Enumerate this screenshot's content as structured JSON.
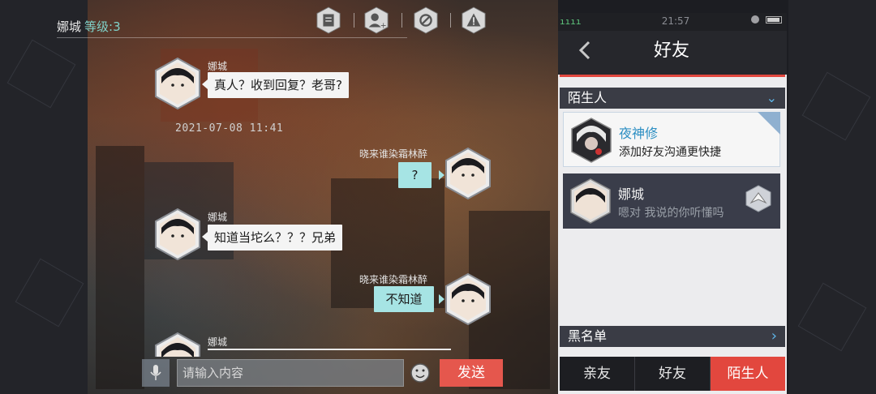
{
  "chat": {
    "header": {
      "name": "娜城",
      "level_label": "等级:3"
    },
    "timestamp": "2021-07-08 11:41",
    "messages": [
      {
        "sender": "娜城",
        "text": "真人？收到回复？老哥?",
        "side": "left"
      },
      {
        "sender": "晓来谁染霜林醉",
        "text": "?",
        "side": "right"
      },
      {
        "sender": "娜城",
        "text": "知道当坨么？？？兄弟",
        "side": "left"
      },
      {
        "sender": "晓来谁染霜林醉",
        "text": "不知道",
        "side": "right"
      },
      {
        "sender": "娜城",
        "text": "",
        "side": "left"
      }
    ],
    "toolbar_icons": [
      "notes-icon",
      "add-friend-icon",
      "block-icon",
      "report-icon"
    ],
    "input": {
      "placeholder": "请输入内容"
    },
    "send_label": "发送"
  },
  "phone": {
    "status": {
      "time": "21:57",
      "signal": "ıııı"
    },
    "title": "好友",
    "strangers_label": "陌生人",
    "blacklist_label": "黑名单",
    "contacts": [
      {
        "name": "夜神修",
        "message": "添加好友沟通更快捷"
      },
      {
        "name": "娜城",
        "message": "嗯对 我说的你听懂吗"
      }
    ],
    "tabs": [
      "亲友",
      "好友",
      "陌生人"
    ],
    "active_tab": "陌生人"
  },
  "colors": {
    "accent_red": "#e2473e",
    "bubble_mine": "#a6e4e4",
    "level_teal": "#7fd1c8",
    "link_blue": "#2d8fc3"
  }
}
